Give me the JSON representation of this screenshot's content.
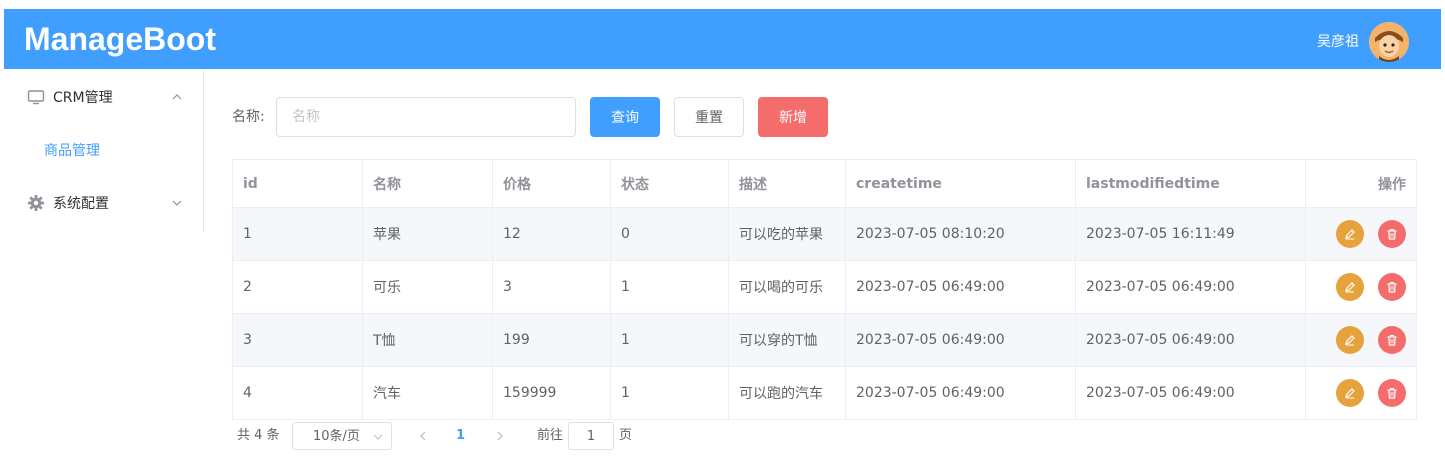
{
  "header": {
    "brand": "ManageBoot",
    "user_name": "吴彦祖"
  },
  "sidebar": {
    "groups": [
      {
        "label": "CRM管理",
        "icon": "monitor-icon",
        "expanded": true,
        "items": [
          {
            "label": "商品管理",
            "active": true
          }
        ]
      },
      {
        "label": "系统配置",
        "icon": "gear-icon",
        "expanded": false,
        "items": []
      }
    ]
  },
  "search": {
    "label": "名称:",
    "placeholder": "名称",
    "value": ""
  },
  "toolbar": {
    "query_label": "查询",
    "reset_label": "重置",
    "add_label": "新增"
  },
  "table": {
    "columns": [
      "id",
      "名称",
      "价格",
      "状态",
      "描述",
      "createtime",
      "lastmodifiedtime",
      "操作"
    ],
    "rows": [
      [
        "1",
        "苹果",
        "12",
        "0",
        "可以吃的苹果",
        "2023-07-05 08:10:20",
        "2023-07-05 16:11:49"
      ],
      [
        "2",
        "可乐",
        "3",
        "1",
        "可以喝的可乐",
        "2023-07-05 06:49:00",
        "2023-07-05 06:49:00"
      ],
      [
        "3",
        "T恤",
        "199",
        "1",
        "可以穿的T恤",
        "2023-07-05 06:49:00",
        "2023-07-05 06:49:00"
      ],
      [
        "4",
        "汽车",
        "159999",
        "1",
        "可以跑的汽车",
        "2023-07-05 06:49:00",
        "2023-07-05 06:49:00"
      ]
    ]
  },
  "pagination": {
    "total": "共 4 条",
    "page_size": "10条/页",
    "current": "1",
    "goto_label": "前往",
    "goto_value": "1",
    "page_suffix": "页"
  },
  "colors": {
    "primary": "#409eff",
    "danger": "#f56c6c",
    "warning": "#e6a23c"
  }
}
